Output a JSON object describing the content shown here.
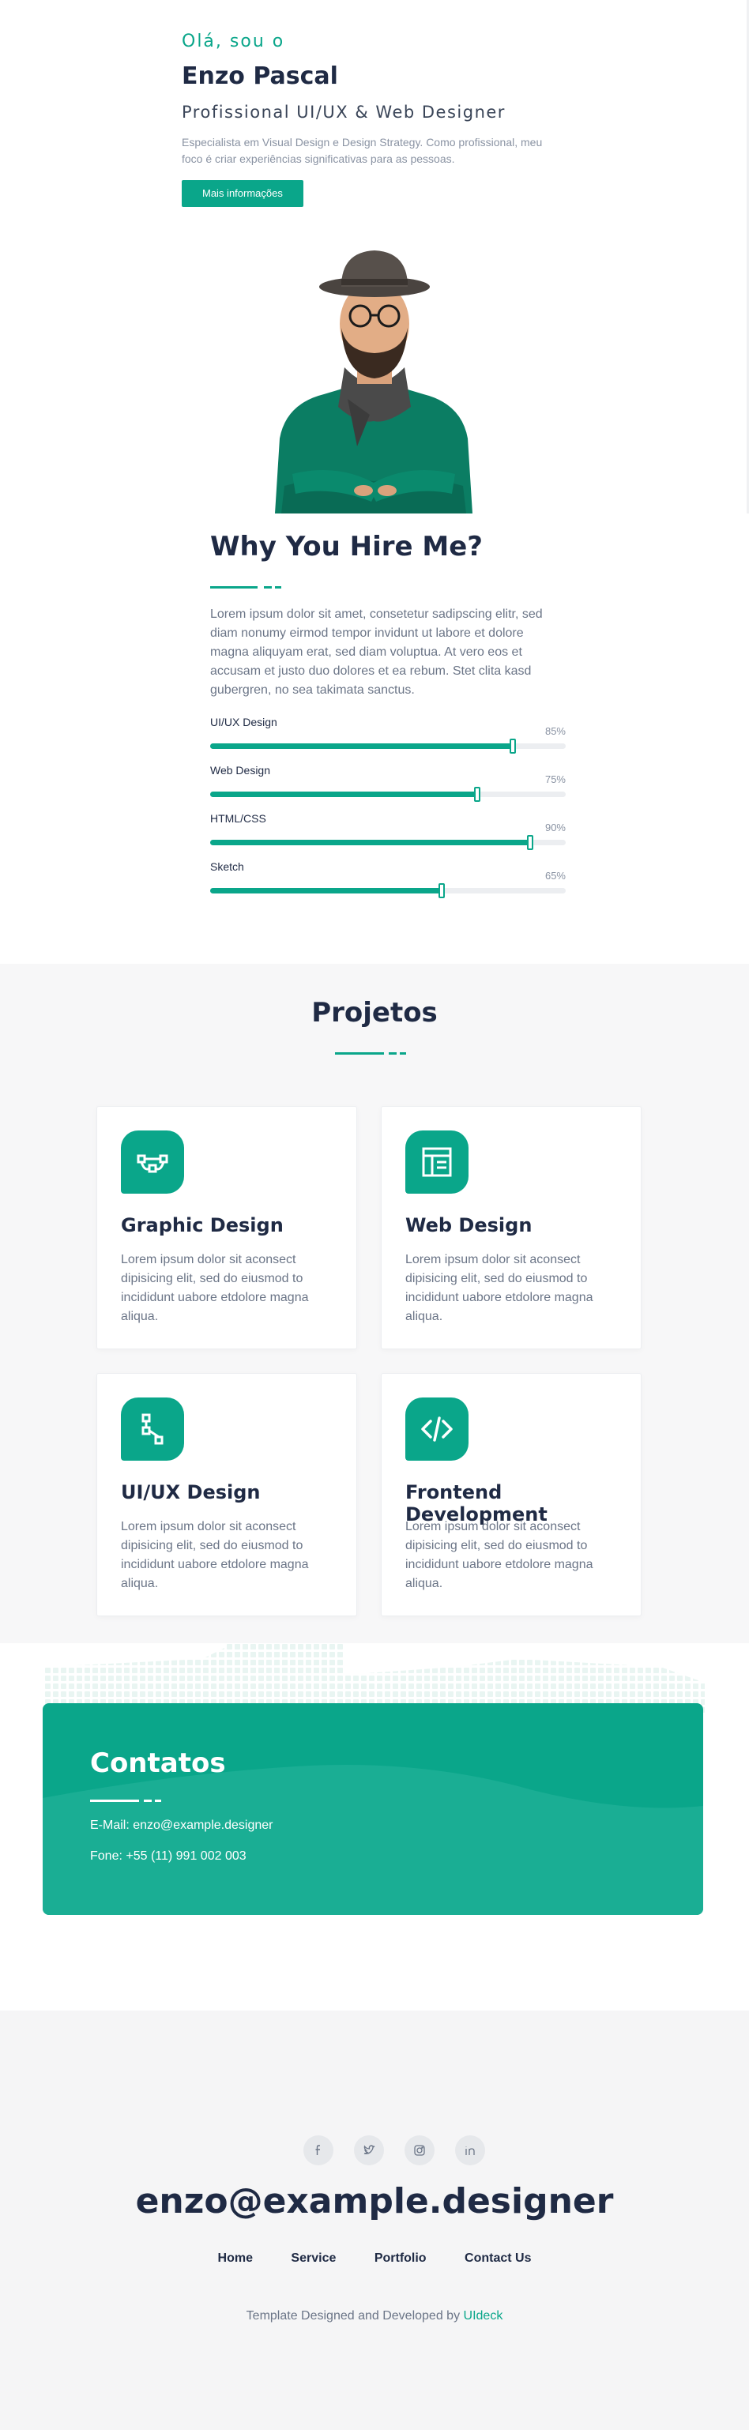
{
  "hero": {
    "greeting": "Olá, sou o",
    "name": "Enzo Pascal",
    "role": "Profissional UI/UX & Web Designer",
    "description": "Especialista em Visual Design e Design Strategy. Como profissional, meu foco é criar experiências significativas para as pessoas.",
    "button": "Mais informações"
  },
  "why": {
    "title": "Why You Hire Me?",
    "text": "Lorem ipsum dolor sit amet, consetetur sadipscing elitr, sed diam nonumy eirmod tempor invidunt ut labore et dolore magna aliquyam erat, sed diam voluptua. At vero eos et accusam et justo duo dolores et ea rebum. Stet clita kasd gubergren, no sea takimata sanctus.",
    "skills": [
      {
        "label": "UI/UX Design",
        "pct": "85%",
        "value": 0.85
      },
      {
        "label": "Web Design",
        "pct": "75%",
        "value": 0.75
      },
      {
        "label": "HTML/CSS",
        "pct": "90%",
        "value": 0.9
      },
      {
        "label": "Sketch",
        "pct": "65%",
        "value": 0.65
      }
    ]
  },
  "projects": {
    "title": "Projetos",
    "cards": [
      {
        "title": "Graphic Design",
        "body": "Lorem ipsum dolor sit aconsect dipisicing elit, sed do eiusmod to incididunt uabore etdolore magna aliqua.",
        "icon": "graphic-design-icon"
      },
      {
        "title": "Web Design",
        "body": "Lorem ipsum dolor sit aconsect dipisicing elit, sed do eiusmod to incididunt uabore etdolore magna aliqua.",
        "icon": "layout-icon"
      },
      {
        "title": "UI/UX Design",
        "body": "Lorem ipsum dolor sit aconsect dipisicing elit, sed do eiusmod to incididunt uabore etdolore magna aliqua.",
        "icon": "flow-icon"
      },
      {
        "title": "Frontend Development",
        "body": "Lorem ipsum dolor sit aconsect dipisicing elit, sed do eiusmod to incididunt uabore etdolore magna aliqua.",
        "icon": "code-icon"
      }
    ]
  },
  "contact": {
    "title": "Contatos",
    "email": "E-Mail: enzo@example.designer",
    "phone": "Fone: +55 (11) 991 002 003"
  },
  "footer": {
    "socials": [
      "facebook-icon",
      "twitter-icon",
      "instagram-icon",
      "linkedin-icon"
    ],
    "email": "enzo@example.designer",
    "nav": [
      "Home",
      "Service",
      "Portfolio",
      "Contact Us"
    ],
    "credit_prefix": "Template Designed and Developed by",
    "credit_link": "UIdeck"
  },
  "colors": {
    "accent": "#0aa68a",
    "heading": "#1f2a44",
    "muted": "#6b7587"
  }
}
